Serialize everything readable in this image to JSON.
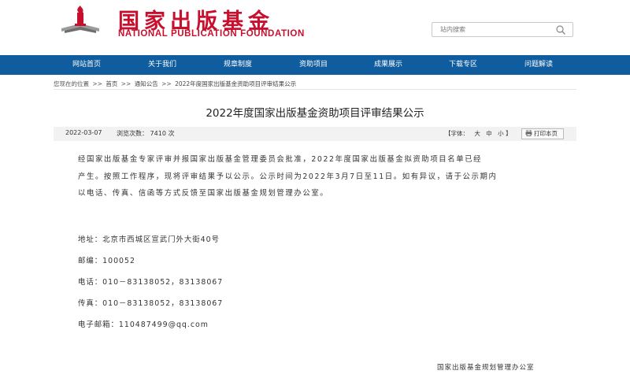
{
  "header": {
    "logo_cn": "国家出版基金",
    "logo_en": "NATIONAL PUBLICATION FOUNDATION",
    "search_placeholder": "站内搜索"
  },
  "nav": {
    "items": [
      {
        "label": "网站首页"
      },
      {
        "label": "关于我们"
      },
      {
        "label": "规章制度"
      },
      {
        "label": "资助项目"
      },
      {
        "label": "成果展示"
      },
      {
        "label": "下载专区"
      },
      {
        "label": "问题解读"
      }
    ]
  },
  "breadcrumb": {
    "prefix": "您现在的位置",
    "sep": ">>",
    "items": [
      "首页",
      "通知公告",
      "2022年度国家出版基金资助项目评审结果公示"
    ]
  },
  "article": {
    "title": "2022年度国家出版基金资助项目评审结果公示",
    "date": "2022-03-07",
    "views_label": "浏览次数：",
    "views_value": "7410",
    "views_unit": "次",
    "font_size_label": "【字体：",
    "font_sizes": [
      "大",
      "中",
      "小"
    ],
    "font_size_close": "】",
    "print_label": "打印本页",
    "paragraph_lines": [
      "经国家出版基金专家评审并报国家出版基金管理委员会批准，2022年度国家出版基金拟资助项目名单已经",
      "产生。按照工作程序，现将评审结果予以公示。公示时间为2022年3月7日至11日。如有异议，请于公示期内",
      "以电话、传真、信函等方式反馈至国家出版基金规划管理办公室。"
    ],
    "contacts": [
      {
        "label": "地址：",
        "value": "北京市西城区宣武门外大街40号"
      },
      {
        "label": "邮编：",
        "value": "100052"
      },
      {
        "label": "电话：",
        "value": "010－83138052，83138067"
      },
      {
        "label": "传真：",
        "value": "010－83138052，83138067"
      },
      {
        "label": "电子邮箱：",
        "value": "110487499@qq.com"
      }
    ],
    "signature": "国家出版基金规划管理办公室"
  },
  "colors": {
    "brand_red": "#c8102e",
    "nav_blue": "#0f5c9e"
  }
}
